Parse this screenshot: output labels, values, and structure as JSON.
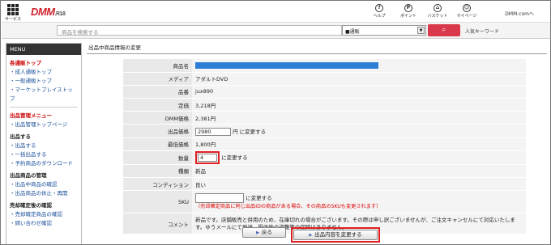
{
  "header": {
    "service_label": "サービス",
    "logo": "DMM",
    "logo_suffix": ".R18",
    "icons": [
      {
        "name": "help",
        "glyph": "?",
        "label": "ヘルプ"
      },
      {
        "name": "point",
        "glyph": "P",
        "label": "ポイント"
      },
      {
        "name": "basket",
        "glyph": "⌂",
        "label": "バスケット"
      },
      {
        "name": "mypage",
        "glyph": "☺",
        "label": "マイページ"
      }
    ],
    "account": "DMM.comへ"
  },
  "search": {
    "placeholder": "商品を検索する",
    "category": "■通販",
    "button_glyph": "⌕",
    "popular_keywords": "人気キーワード"
  },
  "sidebar": {
    "menu_title": "MENU",
    "sec1_title": "各通販トップ",
    "sec1_links": [
      "・成人通販トップ",
      "・一般通販トップ",
      "・マーケットプレイストップ"
    ],
    "sec2_title": "出品管理メニュー",
    "sec2_links": [
      "・出品管理トップページ"
    ],
    "sec3_title": "出品する",
    "sec3_links": [
      "・出品する",
      "・一括出品する",
      "・予約商品のダウンロード"
    ],
    "sec4_title": "出品商品の管理",
    "sec4_links": [
      "・出品中商品の確認",
      "・出品商品の休止・再開"
    ],
    "sec5_title": "売却確定後の確認",
    "sec5_links": [
      "・売却確定商品の確認",
      "・問い合わせ確認"
    ]
  },
  "page": {
    "title": "出品中商品情報の変更",
    "rows": [
      {
        "key": "商品名",
        "value": ""
      },
      {
        "key": "メディア",
        "value": "アダルトDVD"
      },
      {
        "key": "品番",
        "value": "jux890"
      },
      {
        "key": "定価",
        "value": "3,218円"
      },
      {
        "key": "DMM価格",
        "value": "2,381円"
      },
      {
        "key": "出品価格",
        "input": "2980",
        "suffix": "円  に変更する"
      },
      {
        "key": "最低価格",
        "value": "1,800円"
      },
      {
        "key": "数量",
        "input": "4",
        "suffix": "に変更する"
      },
      {
        "key": "種類",
        "value": "新品"
      },
      {
        "key": "コンディション",
        "value": "良い"
      },
      {
        "key": "SKU",
        "input": "",
        "suffix": "に変更する",
        "warning": "（売却確定商品に同じ出品IDの商品がある場合、その商品のSKUも変更されます）"
      },
      {
        "key": "コメント",
        "value": "新品です。店舗販売と併用のため、在庫切れの場合がございます。その際は申し訳ございませんが、ご注文キャンセルにて対応いたします。ゆうメールにて発送。投函後の盗難等の保障はありません。"
      }
    ],
    "back_button": "戻る",
    "submit_button": "出品内容を変更する"
  }
}
